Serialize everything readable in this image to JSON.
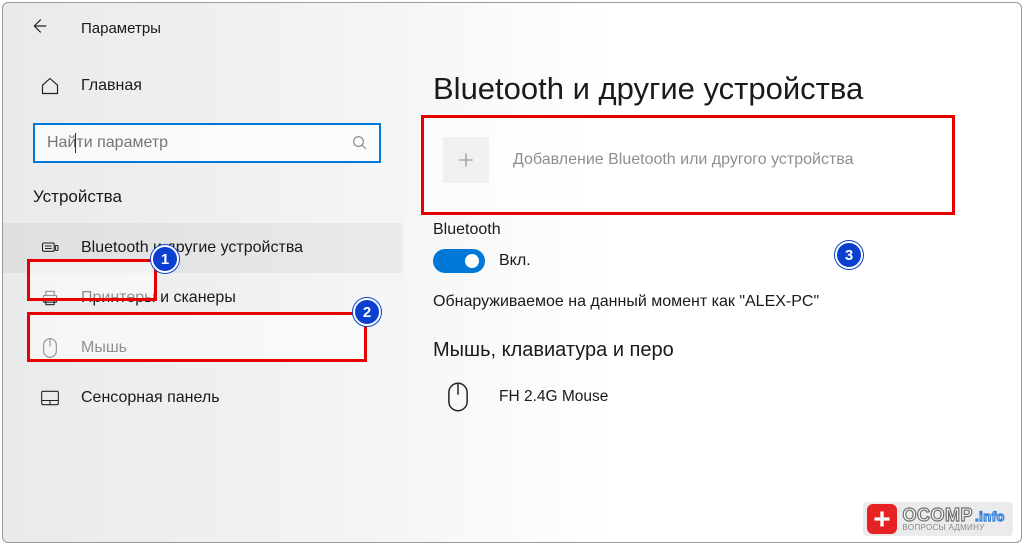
{
  "header": {
    "app_title": "Параметры"
  },
  "sidebar": {
    "home_label": "Главная",
    "search_placeholder": "Найти параметр",
    "category_label": "Устройства",
    "items": [
      {
        "label": "Bluetooth и другие устройства"
      },
      {
        "label": "Принтеры и сканеры"
      },
      {
        "label": "Мышь"
      },
      {
        "label": "Сенсорная панель"
      }
    ]
  },
  "main": {
    "page_heading": "Bluetooth и другие устройства",
    "add_device_label": "Добавление Bluetooth или другого устройства",
    "bluetooth_heading": "Bluetooth",
    "toggle_label": "Вкл.",
    "discoverable_text": "Обнаруживаемое на данный момент как \"ALEX-PC\"",
    "section_heading": "Мышь, клавиатура и перо",
    "devices": [
      {
        "name": "FH 2.4G Mouse"
      }
    ]
  },
  "annotations": {
    "badge1": "1",
    "badge2": "2",
    "badge3": "3"
  },
  "watermark": {
    "top": "OCOMP",
    "info": ".info",
    "bottom": "ВОПРОСЫ АДМИНУ"
  }
}
